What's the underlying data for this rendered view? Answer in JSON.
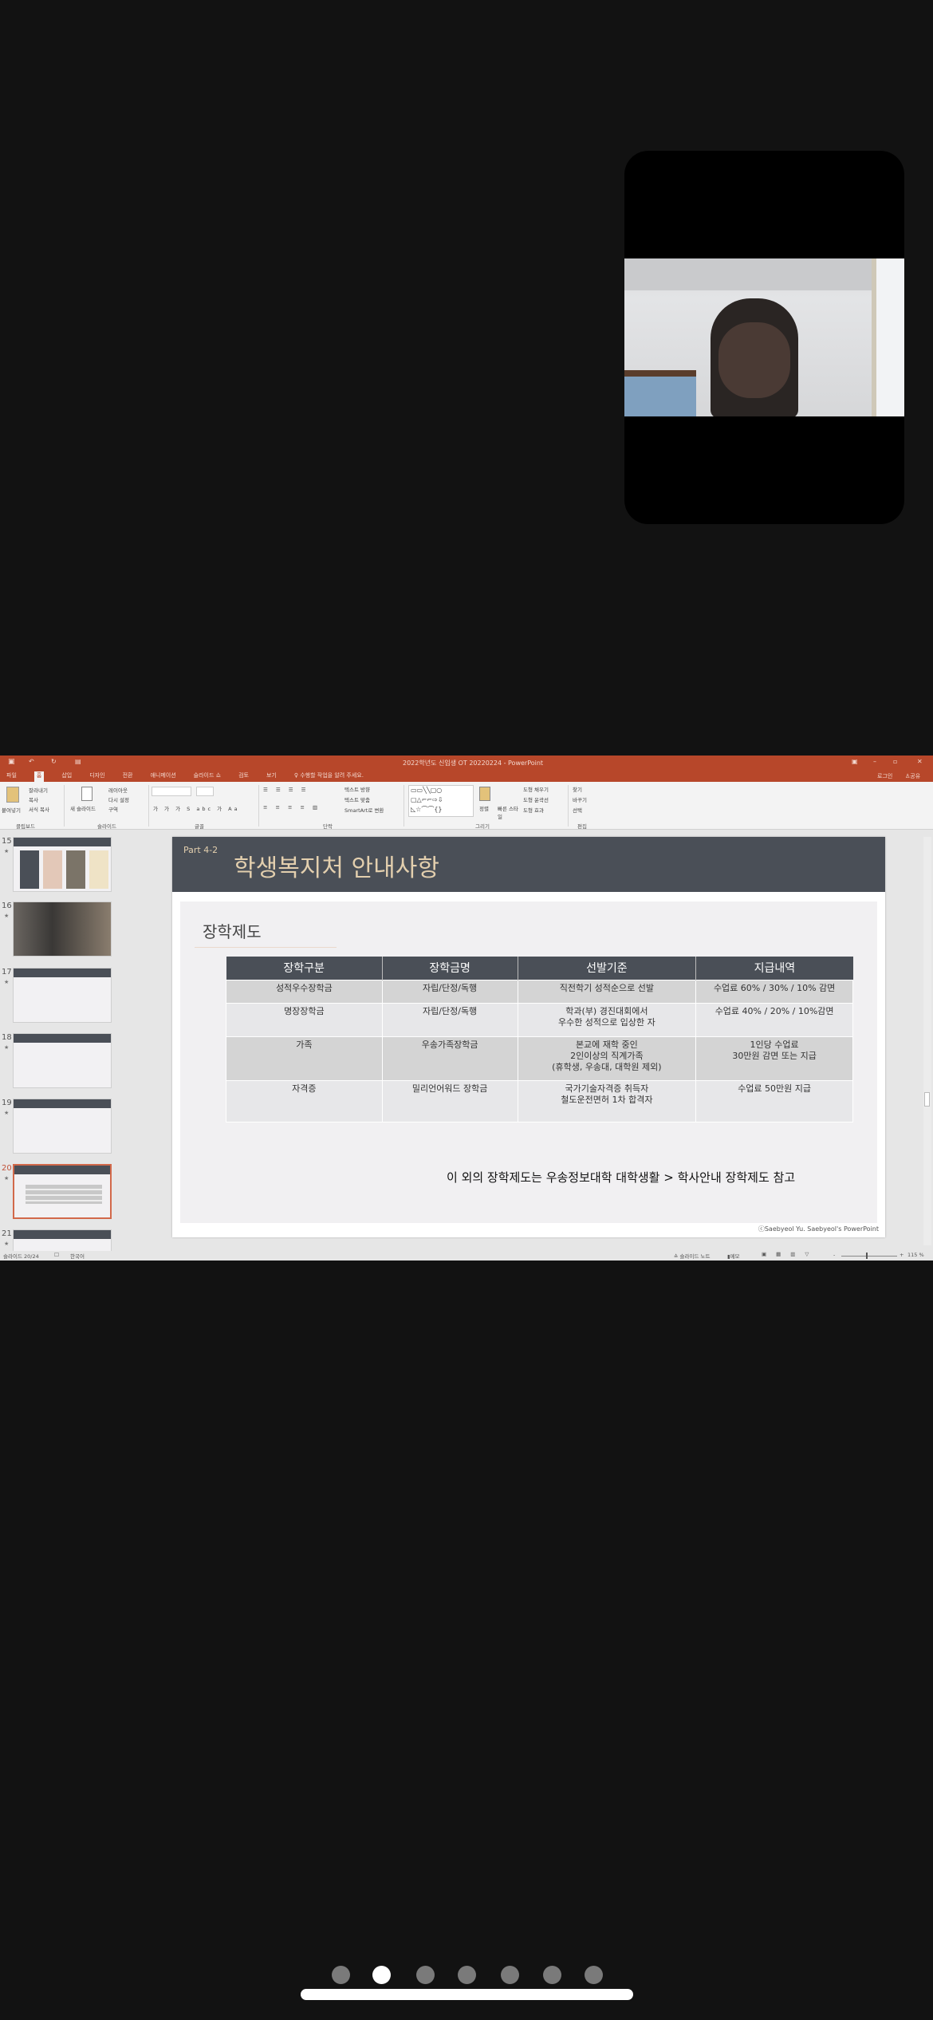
{
  "video_call": {
    "participant_tile": "video-feed"
  },
  "powerpoint": {
    "title": "2022학년도 신입생 OT 20220224 - PowerPoint",
    "tabs": [
      "파일",
      "홈",
      "삽입",
      "디자인",
      "전환",
      "애니메이션",
      "슬라이드 쇼",
      "검토",
      "보기"
    ],
    "tell_me": "수행할 작업을 알려 주세요.",
    "login": "로그인",
    "share": "공유",
    "ribbon": {
      "paste": "붙여넣기",
      "cut": "잘라내기",
      "copy": "복사",
      "format_painter": "서식 복사",
      "new_slide": "새 슬라이드",
      "layout": "레이아웃",
      "reset": "다시 설정",
      "section": "구역",
      "text_direction": "텍스트 방향",
      "align_text": "텍스트 맞춤",
      "smartart": "SmartArt로 변환",
      "arrange": "정렬",
      "quick_styles": "빠른 스타일",
      "shape_fill": "도형 채우기",
      "shape_outline": "도형 윤곽선",
      "shape_effects": "도형 효과",
      "find": "찾기",
      "replace": "바꾸기",
      "select": "선택",
      "groups": [
        "클립보드",
        "슬라이드",
        "글꼴",
        "단락",
        "그리기",
        "편집"
      ]
    },
    "thumbnails": [
      {
        "num": "15"
      },
      {
        "num": "16"
      },
      {
        "num": "17"
      },
      {
        "num": "18"
      },
      {
        "num": "19"
      },
      {
        "num": "20",
        "selected": true
      },
      {
        "num": "21"
      }
    ],
    "slide": {
      "part": "Part 4-2",
      "title": "학생복지처 안내사항",
      "subtitle": "장학제도",
      "table": {
        "headers": [
          "장학구분",
          "장학금명",
          "선발기준",
          "지급내역"
        ],
        "rows": [
          [
            "성적우수장학금",
            "자립/단정/독행",
            "직전학기 성적순으로 선발",
            "수업료 60% / 30% / 10% 감면"
          ],
          [
            "명장장학금",
            "자립/단정/독행",
            "학과(부) 경진대회에서\n우수한 성적으로 입상한 자",
            "수업료 40% / 20% / 10%감면"
          ],
          [
            "가족",
            "우송가족장학금",
            "본교에 재학 중인\n2인이상의 직계가족\n(휴학생, 우송대, 대학원 제외)",
            "1인당 수업료\n30만원 감면 또는 지급"
          ],
          [
            "자격증",
            "밀리언어워드 장학금",
            "국가기술자격증 취득자\n철도운전면허 1차 합격자",
            "수업료 50만원 지급"
          ]
        ]
      },
      "note": "이 외의 장학제도는 우송정보대학 대학생활 > 학사안내 장학제도 참고",
      "copyright": "ⓒSaebyeol Yu. Saebyeol's PowerPoint"
    },
    "status": {
      "slide": "슬라이드 20/24",
      "language": "한국어",
      "notes": "슬라이드 노트",
      "comments": "메모",
      "zoom": "115 %"
    },
    "colors": {
      "titlebar": "#b7472a",
      "slide_header": "#4a4f57",
      "title_text": "#e3cfae"
    }
  },
  "pager": {
    "count": 7,
    "active": 1
  }
}
